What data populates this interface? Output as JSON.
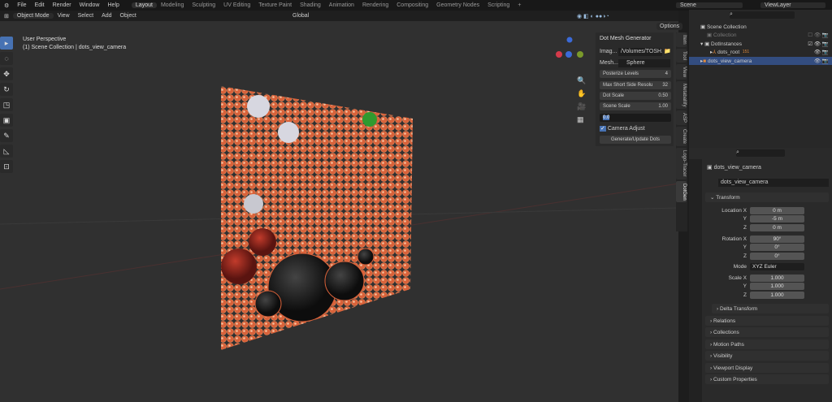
{
  "menu": [
    "File",
    "Edit",
    "Render",
    "Window",
    "Help"
  ],
  "workspaces": [
    "Layout",
    "Modeling",
    "Sculpting",
    "UV Editing",
    "Texture Paint",
    "Shading",
    "Animation",
    "Rendering",
    "Compositing",
    "Geometry Nodes",
    "Scripting",
    "+"
  ],
  "scene": "Scene",
  "view_layer": "ViewLayer",
  "header": {
    "mode": "Object Mode",
    "menus": [
      "View",
      "Select",
      "Add",
      "Object"
    ],
    "orientation": "Global",
    "options": "Options"
  },
  "overlay": {
    "line1": "User Perspective",
    "line2": "(1) Scene Collection | dots_view_camera"
  },
  "npanel": {
    "title": "Dot Mesh Generator",
    "image_label": "Imag...",
    "image_value": "/Volumes/TOSH...",
    "mesh_label": "Mesh...",
    "mesh_value": "Sphere",
    "fields": [
      {
        "label": "Posterize Levels",
        "value": "4"
      },
      {
        "label": "Max Short Side Resolu",
        "value": "32"
      },
      {
        "label": "Dot Scale",
        "value": "0.50"
      },
      {
        "label": "Scene Scale",
        "value": "1.00"
      }
    ],
    "edit_value": "0.0",
    "camera_adjust": "Camera Adjust",
    "generate": "Generate/Update Dots"
  },
  "ntabs": [
    "Item",
    "Tool",
    "View",
    "Metaballify",
    "ASP",
    "Create",
    "Logo-Tracer",
    "DotGen"
  ],
  "outliner": {
    "root": "Scene Collection",
    "items": [
      "Collection",
      "DotInstances",
      "dots_root",
      "dots_view_camera"
    ],
    "badge": "151"
  },
  "props": {
    "object": "dots_view_camera",
    "data_name": "dots_view_camera",
    "transform": "Transform",
    "location": {
      "label": "Location X",
      "x": "0 m",
      "y": "-5 m",
      "z": "0 m"
    },
    "rotation": {
      "label": "Rotation X",
      "x": "90°",
      "y": "0°",
      "z": "0°"
    },
    "mode": {
      "label": "Mode",
      "value": "XYZ Euler"
    },
    "scale": {
      "label": "Scale X",
      "x": "1.000",
      "y": "1.000",
      "z": "1.000"
    },
    "axis": {
      "y": "Y",
      "z": "Z"
    },
    "sections": [
      "Delta Transform",
      "Relations",
      "Collections",
      "Motion Paths",
      "Visibility",
      "Viewport Display",
      "Custom Properties"
    ]
  }
}
